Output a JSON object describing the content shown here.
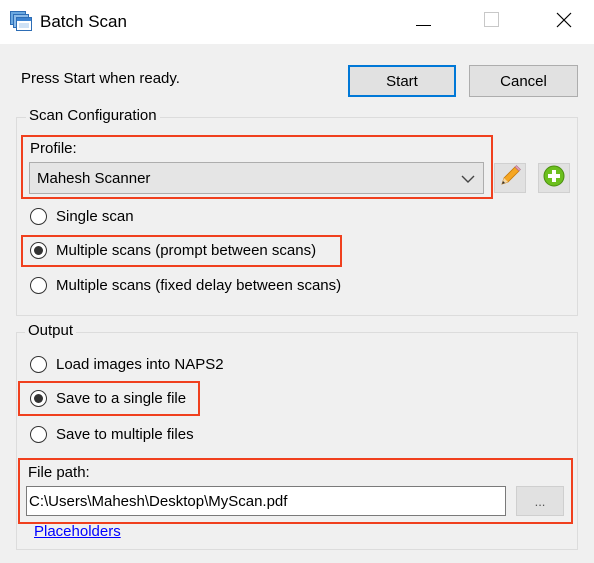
{
  "window": {
    "title": "Batch Scan",
    "icon": "batch-scan-window-icon",
    "controls": [
      "minimize-icon",
      "maximize-icon",
      "close-icon"
    ]
  },
  "status_text": "Press Start when ready.",
  "buttons": {
    "start": "Start",
    "cancel": "Cancel"
  },
  "scan_configuration": {
    "group_label": "Scan Configuration",
    "profile_label": "Profile:",
    "profile_value": "Mahesh Scanner",
    "edit_icon": "pencil-icon",
    "add_icon": "green-plus-icon",
    "options": [
      {
        "label": "Single scan",
        "selected": false
      },
      {
        "label": "Multiple scans (prompt between scans)",
        "selected": true
      },
      {
        "label": "Multiple scans (fixed delay between scans)",
        "selected": false
      }
    ]
  },
  "output": {
    "group_label": "Output",
    "options": [
      {
        "label": "Load images into NAPS2",
        "selected": false
      },
      {
        "label": "Save to a single file",
        "selected": true
      },
      {
        "label": "Save to multiple files",
        "selected": false
      }
    ],
    "file_path_label": "File path:",
    "file_path_value": "C:\\Users\\Mahesh\\Desktop\\MyScan.pdf",
    "browse_label": "...",
    "placeholders_link": "Placeholders"
  },
  "colors": {
    "highlight": "#f0401e",
    "default_button_border": "#0078d7",
    "link": "#0000ff"
  }
}
